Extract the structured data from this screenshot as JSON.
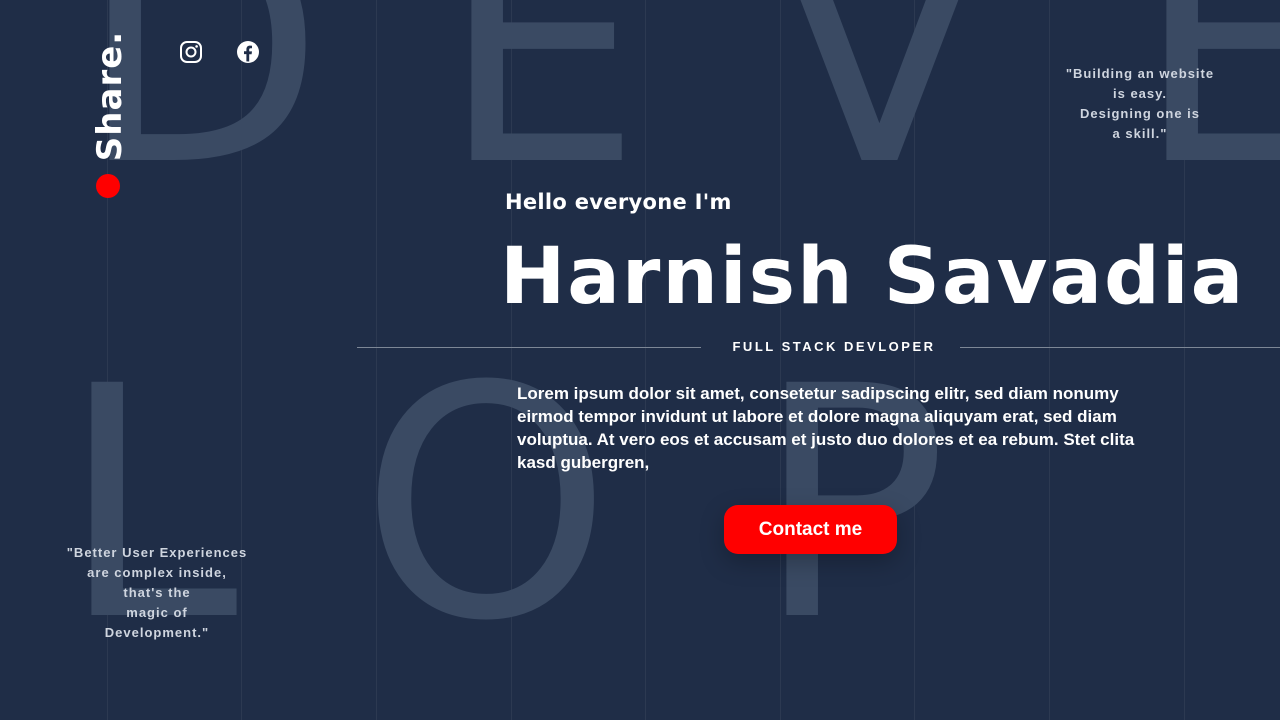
{
  "background_letters": {
    "top": [
      "D",
      "E",
      "V",
      "E"
    ],
    "bottom": [
      "L",
      "O",
      "P"
    ]
  },
  "sidebar": {
    "brand": "Share.",
    "accent_color": "#ff0000"
  },
  "social": [
    {
      "name": "instagram-icon"
    },
    {
      "name": "facebook-icon"
    }
  ],
  "quotes": {
    "top_right": "\"Building an website\nis easy.\nDesigning one is\na skill.\"",
    "bottom_left": "\"Better User Experiences\nare complex inside,\nthat's the\nmagic of\nDevelopment.\""
  },
  "hero": {
    "greeting": "Hello everyone I'm",
    "name": "Harnish Savadia",
    "role": "FULL STACK DEVLOPER",
    "description": "Lorem ipsum dolor sit amet, consetetur sadipscing elitr, sed diam nonumy eirmod tempor invidunt ut labore et dolore magna aliquyam erat, sed diam voluptua. At vero eos et accusam et justo duo dolores et ea rebum. Stet clita kasd gubergren,",
    "cta_label": "Contact me"
  },
  "colors": {
    "background": "#1f2d47",
    "letter": "#3a4a63",
    "accent": "#ff0000"
  }
}
